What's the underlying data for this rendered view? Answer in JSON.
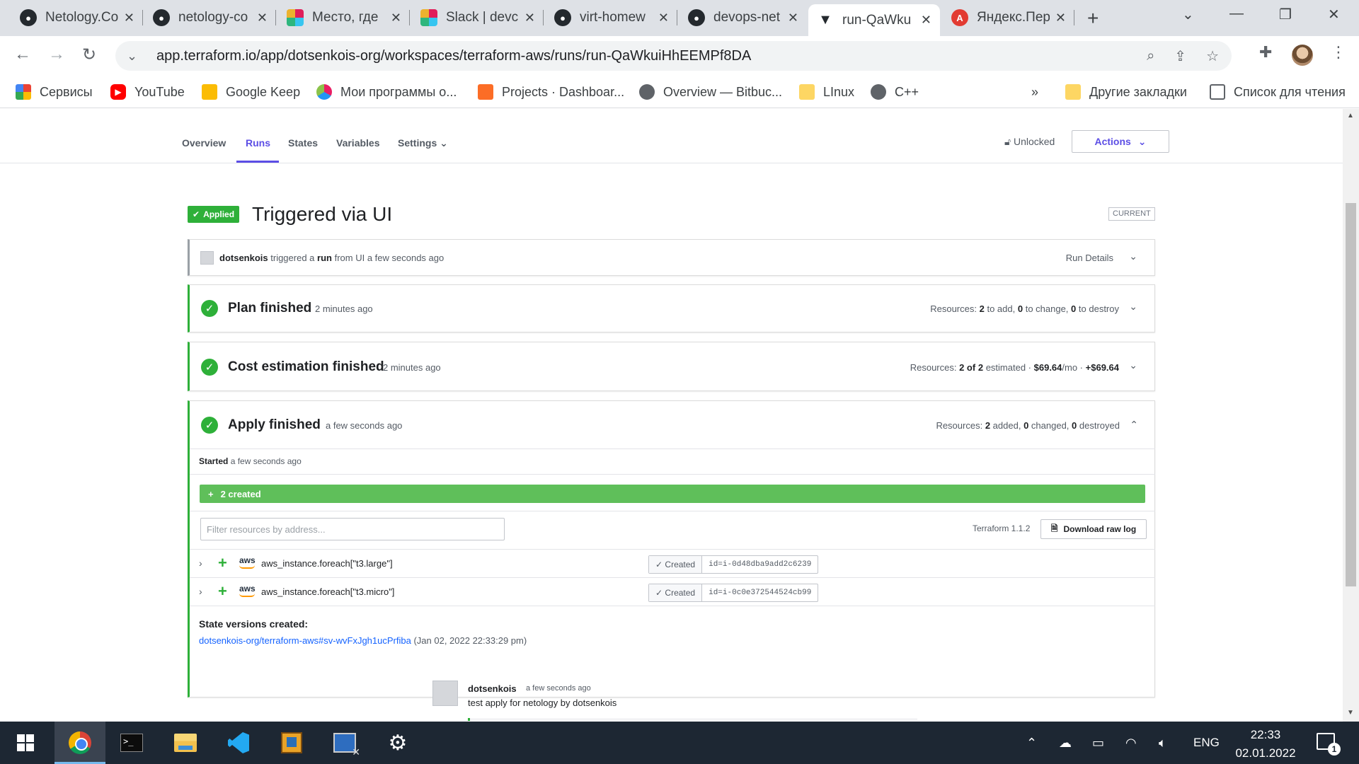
{
  "browser": {
    "tabs": [
      {
        "title": "Netology.Co",
        "icon": "github-icon"
      },
      {
        "title": "netology-co",
        "icon": "github-icon"
      },
      {
        "title": "Место, где",
        "icon": "slack-icon"
      },
      {
        "title": "Slack | devc",
        "icon": "slack-icon"
      },
      {
        "title": "virt-homew",
        "icon": "github-icon"
      },
      {
        "title": "devops-net",
        "icon": "github-icon"
      },
      {
        "title": "run-QaWku",
        "icon": "terraform-icon"
      },
      {
        "title": "Яндекс.Пер",
        "icon": "yandex-translate-icon"
      }
    ],
    "url": "app.terraform.io/app/dotsenkois-org/workspaces/terraform-aws/runs/run-QaWkuiHhEEMPf8DA",
    "bookmarks": [
      {
        "label": "Сервисы",
        "icon": "apps-grid-icon"
      },
      {
        "label": "YouTube",
        "icon": "youtube-icon"
      },
      {
        "label": "Google Keep",
        "icon": "google-keep-icon"
      },
      {
        "label": "Мои программы о...",
        "icon": "apps-icon"
      },
      {
        "label": "Projects · Dashboar...",
        "icon": "gitlab-icon"
      },
      {
        "label": "Overview — Bitbuc...",
        "icon": "globe-icon"
      },
      {
        "label": "LInux",
        "icon": "folder-icon"
      },
      {
        "label": "C++",
        "icon": "globe-icon"
      }
    ],
    "more_bookmarks": "»",
    "other_bookmarks": "Другие закладки",
    "reading_list": "Список для чтения"
  },
  "workspace_nav": {
    "items": [
      "Overview",
      "Runs",
      "States",
      "Variables",
      "Settings"
    ],
    "active": "Runs",
    "lock_status": "Unlocked",
    "actions_label": "Actions"
  },
  "run": {
    "status_badge": "Applied",
    "title": "Triggered via UI",
    "current_label": "CURRENT",
    "trigger": {
      "user": "dotsenkois",
      "text1": "triggered a",
      "run_word": "run",
      "text2": "from UI a few seconds ago",
      "details_label": "Run Details"
    },
    "plan": {
      "title": "Plan finished",
      "time": "2 minutes ago",
      "summary_prefix": "Resources:",
      "to_add": "2",
      "to_add_label": "to add,",
      "to_change": "0",
      "to_change_label": "to change,",
      "to_destroy": "0",
      "to_destroy_label": "to destroy"
    },
    "cost": {
      "title": "Cost estimation finished",
      "time": "2 minutes ago",
      "summary_prefix": "Resources:",
      "estimated": "2 of 2",
      "estimated_label": "estimated ·",
      "monthly": "$69.64",
      "monthly_suffix": "/mo ·",
      "delta": "+$69.64"
    },
    "apply": {
      "title": "Apply finished",
      "time": "a few seconds ago",
      "summary_prefix": "Resources:",
      "added": "2",
      "added_label": "added,",
      "changed": "0",
      "changed_label": "changed,",
      "destroyed": "0",
      "destroyed_label": "destroyed",
      "started_label": "Started",
      "started_time": "a few seconds ago",
      "created_bar": "2 created",
      "filter_placeholder": "Filter resources by address...",
      "terraform_version": "Terraform 1.1.2",
      "download_label": "Download raw log",
      "resources": [
        {
          "provider": "aws",
          "address": "aws_instance.foreach[\"t3.large\"]",
          "status": "Created",
          "id": "id=i-0d48dba9add2c6239"
        },
        {
          "provider": "aws",
          "address": "aws_instance.foreach[\"t3.micro\"]",
          "status": "Created",
          "id": "id=i-0c0e372544524cb99"
        }
      ],
      "state_versions_label": "State versions created:",
      "state_link": "dotsenkois-org/terraform-aws#sv-wvFxJgh1ucPrfiba",
      "state_date": "(Jan 02, 2022 22:33:29 pm)"
    },
    "comment": {
      "user": "dotsenkois",
      "time": "a few seconds ago",
      "text": "test apply for netology by dotsenkois"
    }
  },
  "taskbar": {
    "apps": [
      "start-icon",
      "chrome-icon",
      "terminal-icon",
      "file-explorer-icon",
      "vscode-icon",
      "app-icon",
      "remote-desktop-icon",
      "settings-icon"
    ],
    "language": "ENG",
    "time": "22:33",
    "date": "02.01.2022",
    "notifications": "1"
  },
  "colors": {
    "accent": "#5c4ee5",
    "success": "#2eb039",
    "link": "#1563ff"
  }
}
